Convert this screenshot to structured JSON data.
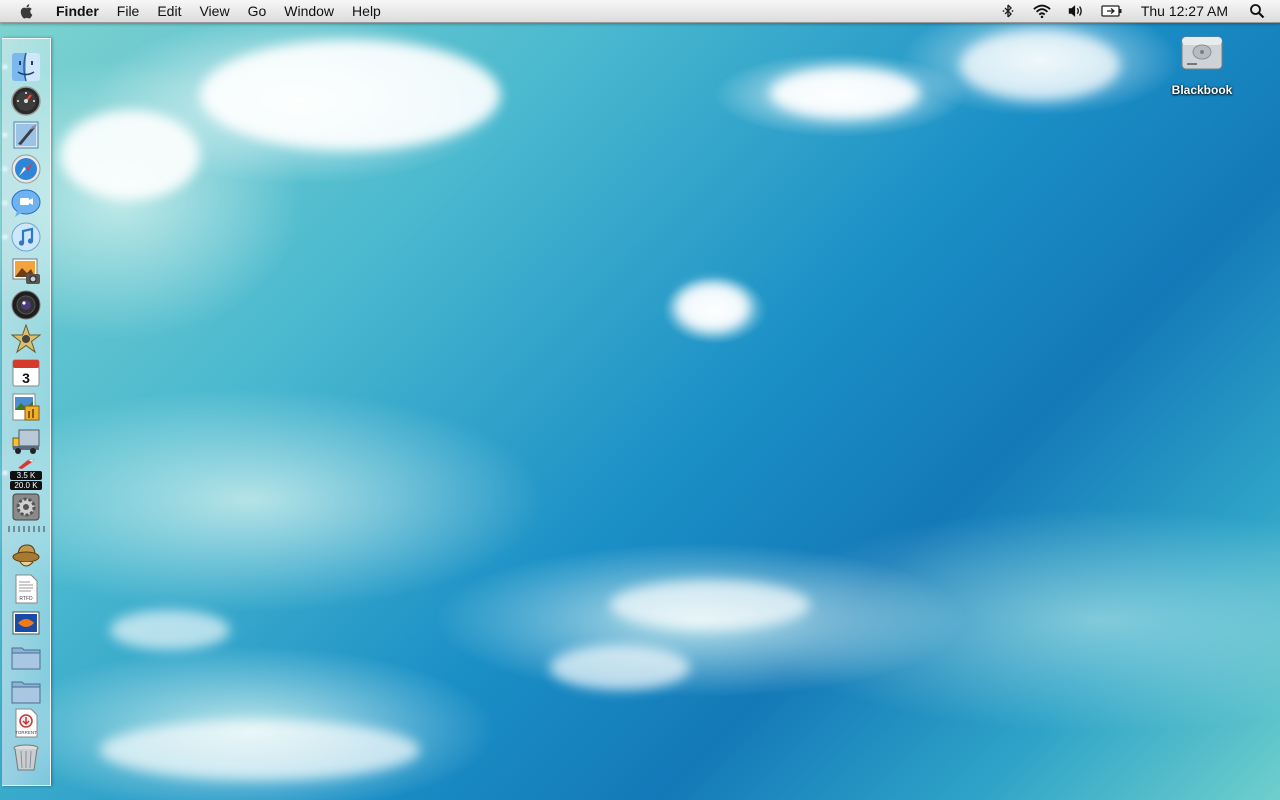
{
  "menubar": {
    "app_name": "Finder",
    "menus": [
      "File",
      "Edit",
      "View",
      "Go",
      "Window",
      "Help"
    ],
    "clock": "Thu 12:27 AM",
    "status_icons": [
      "bluetooth-icon",
      "wifi-icon",
      "volume-icon",
      "battery-icon",
      "spotlight-icon"
    ]
  },
  "dock": {
    "items": [
      {
        "name": "finder-icon",
        "running": true
      },
      {
        "name": "dashboard-icon",
        "running": false
      },
      {
        "name": "mail-icon",
        "running": true
      },
      {
        "name": "safari-icon",
        "running": true
      },
      {
        "name": "ichat-icon",
        "running": true
      },
      {
        "name": "itunes-icon",
        "running": true
      },
      {
        "name": "iphoto-icon",
        "running": false
      },
      {
        "name": "photo-booth-icon",
        "running": false
      },
      {
        "name": "imovie-icon",
        "running": false
      },
      {
        "name": "ical-icon",
        "running": false
      },
      {
        "name": "preview-icon",
        "running": false
      },
      {
        "name": "delivery-truck-icon",
        "running": false
      },
      {
        "name": "network-monitor-icon",
        "running": true
      },
      {
        "name": "system-preferences-icon",
        "running": false
      },
      {
        "name": "hat-icon",
        "running": false
      },
      {
        "name": "rtfd-document-icon",
        "running": false
      },
      {
        "name": "picture-document-icon",
        "running": false
      },
      {
        "name": "folder-icon",
        "running": false
      },
      {
        "name": "folder-icon",
        "running": false
      },
      {
        "name": "torrent-document-icon",
        "running": false
      },
      {
        "name": "trash-icon",
        "running": false
      }
    ],
    "ical_day": "3",
    "net_up": "3.5 K",
    "net_down": "20.0 K",
    "doc_rtfd": "RTFD",
    "doc_torrent": "TORRENT"
  },
  "desktop": {
    "drive_label": "Blackbook"
  },
  "colors": {
    "sky_deep": "#1479b8",
    "sky_light": "#7fd3cf",
    "menubar": "#e9e9e9"
  }
}
